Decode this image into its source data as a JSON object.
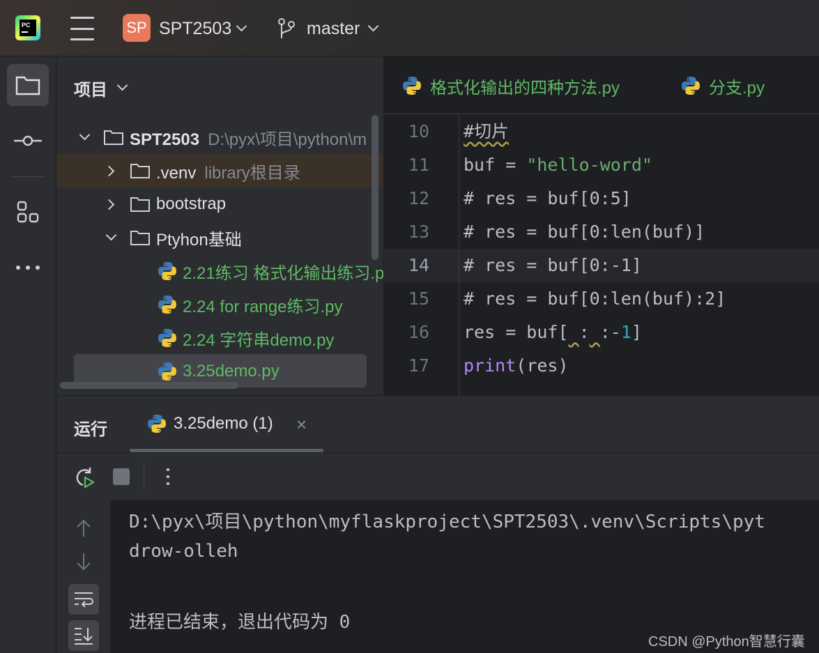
{
  "titlebar": {
    "app_logo_icon": "pycharm-logo",
    "menu_icon": "hamburger-menu-icon",
    "project_badge": "SP",
    "project_name": "SPT2503",
    "branch_icon": "git-branch-icon",
    "branch_name": "master"
  },
  "toolstrip": {
    "items": [
      "folder-icon",
      "commit-icon",
      "structure-icon",
      "more-horizontal-icon"
    ]
  },
  "project_panel": {
    "title": "项目",
    "tree": [
      {
        "label": "SPT2503",
        "hint": "D:\\pyx\\项目\\python\\m"
      },
      {
        "label": ".venv",
        "hint": "library根目录"
      },
      {
        "label": "bootstrap"
      },
      {
        "label": "Ptyhon基础"
      },
      {
        "label": "2.21练习 格式化输出练习.p"
      },
      {
        "label": "2.24 for range练习.py"
      },
      {
        "label": "2.24 字符串demo.py"
      },
      {
        "label": "3.25demo.py"
      }
    ]
  },
  "editor": {
    "tabs": [
      {
        "label": "格式化输出的四种方法.py"
      },
      {
        "label": "分支.py"
      }
    ],
    "current_line": "14",
    "lines": [
      {
        "num": "10",
        "text": "#切片"
      },
      {
        "num": "11",
        "text": "buf = \"hello-word\""
      },
      {
        "num": "12",
        "text": "# res = buf[0:5]"
      },
      {
        "num": "13",
        "text": "# res = buf[0:len(buf)]"
      },
      {
        "num": "14",
        "text": "# res = buf[0:-1]"
      },
      {
        "num": "15",
        "text": "# res = buf[0:len(buf):2]"
      },
      {
        "num": "16",
        "text": "res = buf[ : :-1]"
      },
      {
        "num": "17",
        "text": "print(res)"
      }
    ]
  },
  "run_panel": {
    "title": "运行",
    "tab_label": "3.25demo (1)",
    "close_glyph": "×",
    "console_lines": [
      "D:\\pyx\\项目\\python\\myflaskproject\\SPT2503\\.venv\\Scripts\\pyt",
      "drow-olleh",
      "",
      "进程已结束，退出代码为 0"
    ]
  },
  "watermark": "CSDN @Python智慧行囊"
}
